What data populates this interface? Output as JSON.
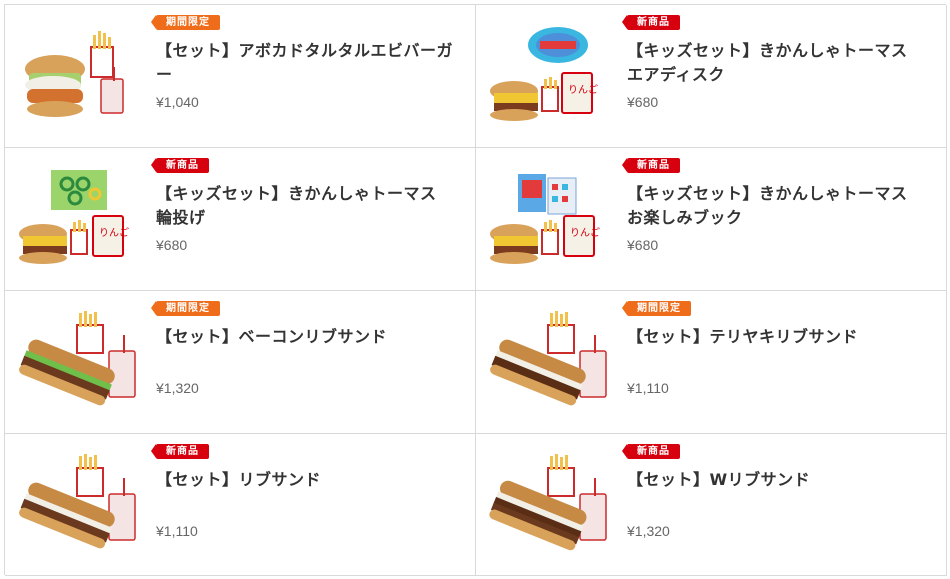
{
  "badges": {
    "new": "新商品",
    "limited": "期間限定"
  },
  "items": [
    {
      "badge": "期間限定",
      "badge_type": "limited",
      "name": "【セット】アボカドタルタルエビバーガー",
      "price": "¥1,040",
      "icon": "avocado-shrimp-burger-set-image"
    },
    {
      "badge": "新商品",
      "badge_type": "new",
      "name": "【キッズセット】きかんしゃトーマス エアディスク",
      "price": "¥680",
      "icon": "kids-set-air-disc-image"
    },
    {
      "badge": "新商品",
      "badge_type": "new",
      "name": "【キッズセット】きかんしゃトーマス 輪投げ",
      "price": "¥680",
      "icon": "kids-set-ring-toss-image"
    },
    {
      "badge": "新商品",
      "badge_type": "new",
      "name": "【キッズセット】きかんしゃトーマス お楽しみブック",
      "price": "¥680",
      "icon": "kids-set-fun-book-image"
    },
    {
      "badge": "期間限定",
      "badge_type": "limited",
      "name": "【セット】ベーコンリブサンド",
      "price": "¥1,320",
      "icon": "bacon-rib-sandwich-set-image"
    },
    {
      "badge": "期間限定",
      "badge_type": "limited",
      "name": "【セット】テリヤキリブサンド",
      "price": "¥1,110",
      "icon": "teriyaki-rib-sandwich-set-image"
    },
    {
      "badge": "新商品",
      "badge_type": "new",
      "name": "【セット】リブサンド",
      "price": "¥1,110",
      "icon": "rib-sandwich-set-image"
    },
    {
      "badge": "新商品",
      "badge_type": "new",
      "name": "【セット】Wリブサンド",
      "price": "¥1,320",
      "icon": "double-rib-sandwich-set-image"
    }
  ],
  "colors": {
    "new_badge": "#d7000f",
    "limited_badge": "#ef6c1a",
    "border": "#d9d9d9",
    "text": "#333333",
    "price": "#666666"
  }
}
